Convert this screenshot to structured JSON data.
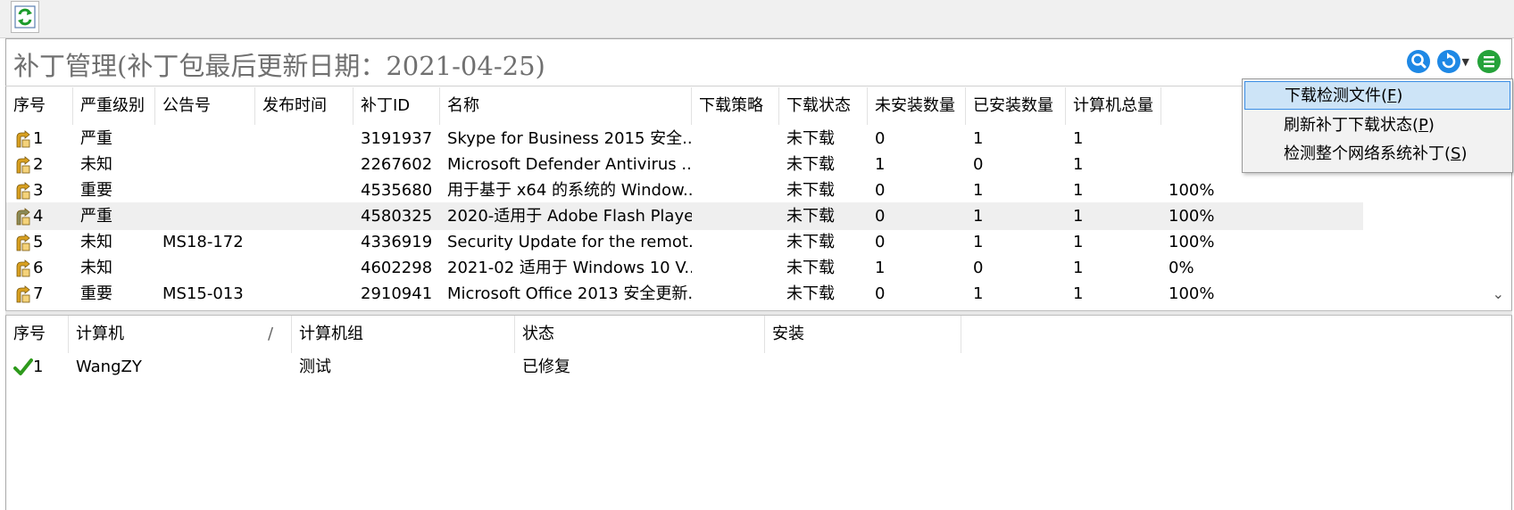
{
  "toolbar": {
    "refresh_icon": "refresh-icon"
  },
  "title": {
    "text": "补丁管理(补丁包最后更新日期：2021-04-25)",
    "icons": [
      "search-icon",
      "refresh-dropdown-icon",
      "menu-icon"
    ]
  },
  "upper_table": {
    "columns": [
      "序号",
      "严重级别",
      "公告号",
      "发布时间",
      "补丁ID",
      "名称",
      "下载策略",
      "下载状态",
      "未安装数量",
      "已安装数量",
      "计算机总量",
      ""
    ],
    "rows": [
      {
        "no": "1",
        "severity": "严重",
        "bulletin": "",
        "date": "",
        "id": "3191937",
        "name": "Skype for Business 2015 安全...",
        "policy": "",
        "status": "未下载",
        "not_installed": "0",
        "installed": "1",
        "total": "1",
        "pct": ""
      },
      {
        "no": "2",
        "severity": "未知",
        "bulletin": "",
        "date": "",
        "id": "2267602",
        "name": "Microsoft Defender Antivirus ...",
        "policy": "",
        "status": "未下载",
        "not_installed": "1",
        "installed": "0",
        "total": "1",
        "pct": ""
      },
      {
        "no": "3",
        "severity": "重要",
        "bulletin": "",
        "date": "",
        "id": "4535680",
        "name": "用于基于 x64 的系统的 Window...",
        "policy": "",
        "status": "未下载",
        "not_installed": "0",
        "installed": "1",
        "total": "1",
        "pct": "100%"
      },
      {
        "no": "4",
        "severity": "严重",
        "bulletin": "",
        "date": "",
        "id": "4580325",
        "name": "2020-适用于 Adobe Flash Playe...",
        "policy": "",
        "status": "未下载",
        "not_installed": "0",
        "installed": "1",
        "total": "1",
        "pct": "100%"
      },
      {
        "no": "5",
        "severity": "未知",
        "bulletin": "MS18-172",
        "date": "",
        "id": "4336919",
        "name": "Security Update for the remot...",
        "policy": "",
        "status": "未下载",
        "not_installed": "0",
        "installed": "1",
        "total": "1",
        "pct": "100%"
      },
      {
        "no": "6",
        "severity": "未知",
        "bulletin": "",
        "date": "",
        "id": "4602298",
        "name": "2021-02 适用于 Windows 10 V...",
        "policy": "",
        "status": "未下载",
        "not_installed": "1",
        "installed": "0",
        "total": "1",
        "pct": "0%"
      },
      {
        "no": "7",
        "severity": "重要",
        "bulletin": "MS15-013",
        "date": "",
        "id": "2910941",
        "name": "Microsoft Office 2013 安全更新...",
        "policy": "",
        "status": "未下载",
        "not_installed": "0",
        "installed": "1",
        "total": "1",
        "pct": "100%"
      }
    ]
  },
  "lower_table": {
    "columns": [
      "序号",
      "计算机",
      "计算机组",
      "状态",
      "安装"
    ],
    "sort_mark": "/",
    "rows": [
      {
        "no": "1",
        "computer": "WangZY",
        "group": "测试",
        "status": "已修复",
        "install": ""
      }
    ]
  },
  "context_menu": {
    "items": [
      {
        "label": "下载检测文件",
        "key": "F"
      },
      {
        "label": "刷新补丁下载状态",
        "key": "P"
      },
      {
        "label": "检测整个网络系统补丁",
        "key": "S"
      }
    ]
  },
  "colors": {
    "title_text": "#707070",
    "menu_highlight": "#cde4f7",
    "menu_highlight_border": "#3a8ee6",
    "selected_row": "#efefef",
    "fix_check": "#2e9a1c"
  }
}
